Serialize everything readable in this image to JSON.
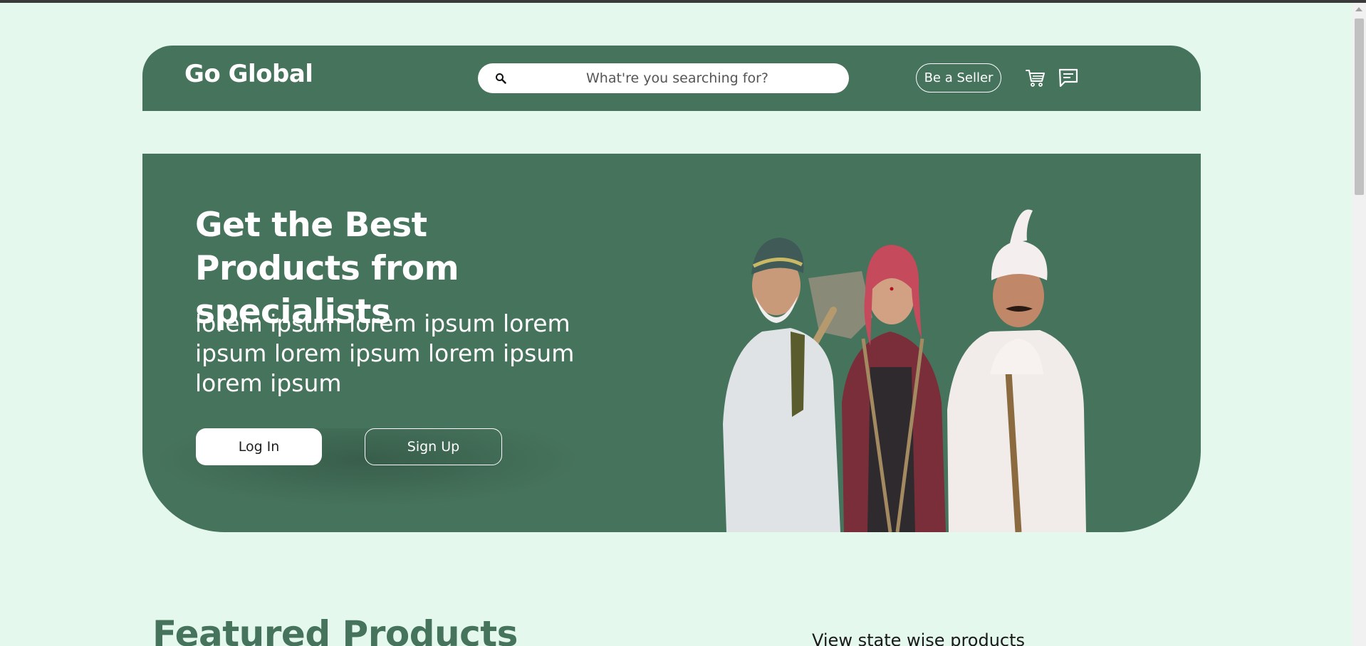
{
  "header": {
    "brand": "Go Global",
    "search_placeholder": "What're you searching for?",
    "seller_label": "Be a Seller",
    "cart_icon": "cart-icon",
    "chat_icon": "message-icon"
  },
  "hero": {
    "title": "Get the Best Products from specialists",
    "text": "lorem ipsum lorem ipsum lorem ipsum lorem ipsum lorem ipsum lorem ipsum",
    "login_label": "Log In",
    "signup_label": "Sign Up",
    "image": "farmers-photo"
  },
  "featured": {
    "title": "Featured Products",
    "state_link": "View state wise products"
  },
  "colors": {
    "page_bg": "#e5f8ed",
    "brand_green": "#46735c",
    "white": "#ffffff"
  }
}
